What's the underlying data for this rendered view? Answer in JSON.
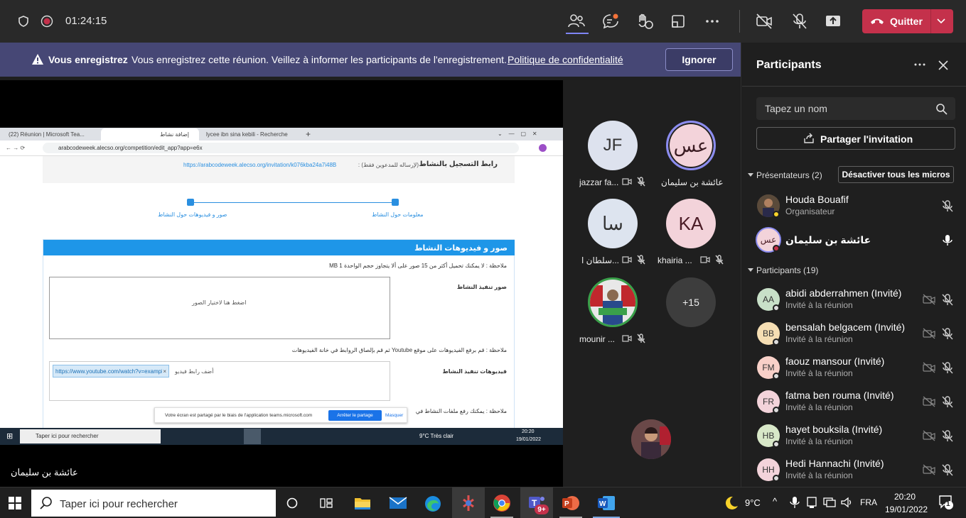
{
  "topbar": {
    "timer": "01:24:15",
    "quit_label": "Quitter"
  },
  "banner": {
    "title": "Vous enregistrez",
    "message": "Vous enregistrez cette réunion. Veillez à informer les participants de l'enregistrement.",
    "link": "Politique de confidentialité",
    "button": "Ignorer"
  },
  "video": {
    "tiles": [
      {
        "initials": "JF",
        "name": "jazzar fa..."
      },
      {
        "initials": "عس",
        "name": "عائشة بن سليمان"
      },
      {
        "initials": "سا",
        "name": "سلطان ا..."
      },
      {
        "initials": "KA",
        "name": "khairia ..."
      },
      {
        "initials": "",
        "name": "mounir ..."
      },
      {
        "initials": "+15",
        "name": ""
      }
    ],
    "presenter_label": "عائشة بن سليمان"
  },
  "shared": {
    "tabs": [
      "(22) Réunion | Microsoft Tea...",
      "إضافة نشاط",
      "lycee ibn sina kebili - Recherche..."
    ],
    "url": "arabcodeweek.alecso.org/competition/edit_app?app=e6x",
    "reg_label": "رابط التسجيل بالنشاط",
    "reg_note": "(لإرساله للمدعوين فقط) :",
    "reg_link": "https://arabcodeweek.alecso.org/invitation/k076kba24a7i48B",
    "step1": "معلومات حول النشاط",
    "step2": "صور و فيديوهات حول النشاط",
    "section_title": "صور و فيديوهات النشاط",
    "note1": "ملاحظة : لا يمكنك تحميل أكثر من 15 صور على ألا يتجاوز حجم الواحدة 1 MB",
    "images_label": "صور تنفيذ النشاط",
    "images_placeholder": "اضغط هنا لاختيار الصور",
    "note2": "ملاحظة : قم برفع الفيديوهات على موقع Youtube ثم قم بإلصاق الروابط في خانة الفيديوهات",
    "videos_label": "فيديوهات تنفيذ النشاط",
    "video_chip": "https://www.youtube.com/watch?v=example",
    "video_add": "أضف رابط فيديو",
    "note3": "ملاحظة : يمكنك رفع ملفات النشاط في",
    "share_bar_text": "Votre écran est partagé par le biais de l'application teams.microsoft.com",
    "share_stop": "Arrêter le partage",
    "share_hide": "Masquer",
    "inner_search": "Taper ici pour rechercher",
    "inner_weather": "9°C  Très clair",
    "inner_time": "20:20",
    "inner_date": "19/01/2022"
  },
  "panel": {
    "title": "Participants",
    "search_placeholder": "Tapez un nom",
    "share_invite": "Partager l'invitation",
    "presenters_header": "Présentateurs (2)",
    "mute_all": "Désactiver tous les micros",
    "participants_header": "Participants (19)",
    "presenters": [
      {
        "initials": "",
        "name": "Houda Bouafif",
        "role": "Organisateur"
      },
      {
        "initials": "عس",
        "name": "عائشة بن سليمان",
        "role": ""
      }
    ],
    "participants": [
      {
        "initials": "AA",
        "name": "abidi abderrahmen (Invité)",
        "role": "Invité à la réunion",
        "color": "#c8e0c8"
      },
      {
        "initials": "BB",
        "name": "bensalah belgacem (Invité)",
        "role": "Invité à la réunion",
        "color": "#f5deb3"
      },
      {
        "initials": "FM",
        "name": "faouz mansour (Invité)",
        "role": "Invité à la réunion",
        "color": "#f8d0c8"
      },
      {
        "initials": "FR",
        "name": "fatma ben rouma (Invité)",
        "role": "Invité à la réunion",
        "color": "#f3d3da"
      },
      {
        "initials": "HB",
        "name": "hayet bouksila (Invité)",
        "role": "Invité à la réunion",
        "color": "#d8e8c8"
      },
      {
        "initials": "HH",
        "name": "Hedi Hannachi (Invité)",
        "role": "Invité à la réunion",
        "color": "#f3d3da"
      }
    ]
  },
  "taskbar": {
    "search_placeholder": "Taper ici pour rechercher",
    "weather": "9°C",
    "lang": "FRA",
    "time": "20:20",
    "date": "19/01/2022",
    "teams_badge": "9+",
    "notif_count": "1"
  }
}
